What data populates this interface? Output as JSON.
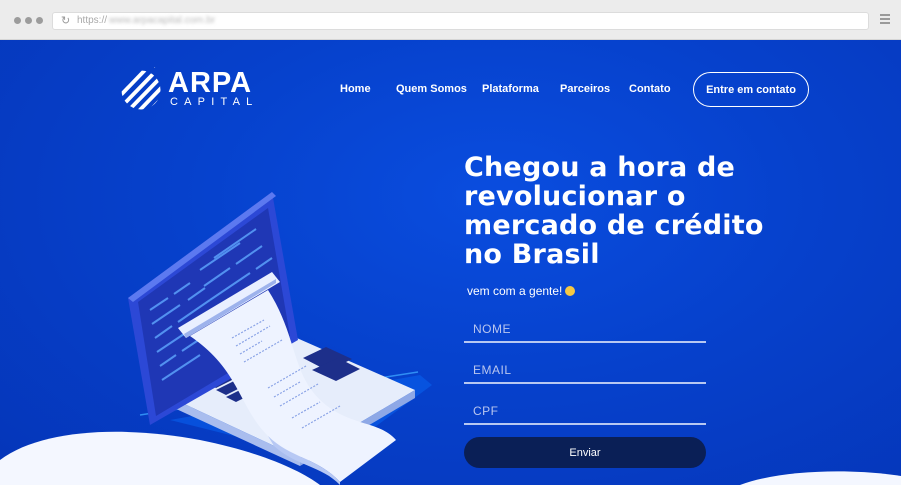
{
  "browser": {
    "url_prefix": "https://",
    "url_blurred": "www.arpacapital.com.br"
  },
  "brand": {
    "name": "ARPA",
    "tagline": "CAPITAL"
  },
  "nav": {
    "items": [
      {
        "label": "Home"
      },
      {
        "label": "Quem Somos"
      },
      {
        "label": "Plataforma"
      },
      {
        "label": "Parceiros"
      },
      {
        "label": "Contato"
      }
    ],
    "cta": "Entre em contato"
  },
  "hero": {
    "title": "Chegou a hora de revolucionar o mercado de crédito no Brasil",
    "subtitle": "vem com a gente!"
  },
  "form": {
    "name_placeholder": "NOME",
    "email_placeholder": "EMAIL",
    "cpf_placeholder": "CPF",
    "submit_label": "Enviar"
  },
  "colors": {
    "background": "#0641cc",
    "button_dark": "#0a1f56",
    "laptop_screen": "#2d4bd6",
    "receipt": "#e8efff"
  }
}
